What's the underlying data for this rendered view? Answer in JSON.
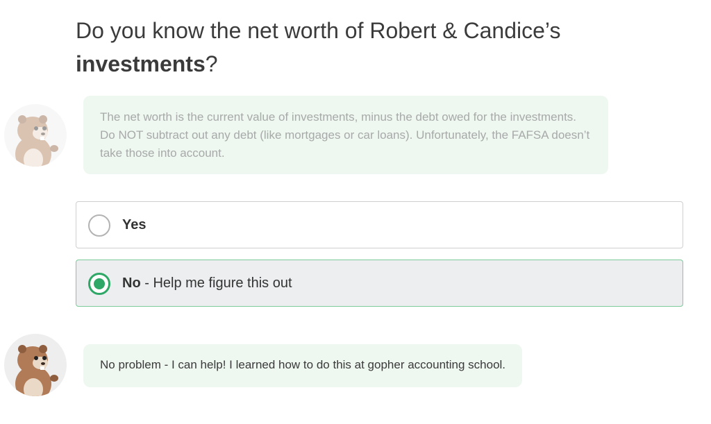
{
  "question": {
    "prefix": "Do you know the net worth of Robert & Candice’s",
    "bold": "investments",
    "suffix": "?"
  },
  "hint": {
    "text": "The net worth is the current value of investments, minus the debt owed for the investments. Do NOT subtract out any debt (like mortgages or car loans). Unfortunately, the FAFSA doesn’t take those into account."
  },
  "options": [
    {
      "label": "Yes",
      "detail": "",
      "selected": false
    },
    {
      "label": "No",
      "detail": " - Help me figure this out",
      "selected": true
    }
  ],
  "reply": {
    "text": "No problem - I can help! I learned how to do this at gopher accounting school."
  },
  "colors": {
    "accent": "#2fa867",
    "bubble": "#eef7f0",
    "selected_bg": "#eceeef"
  }
}
